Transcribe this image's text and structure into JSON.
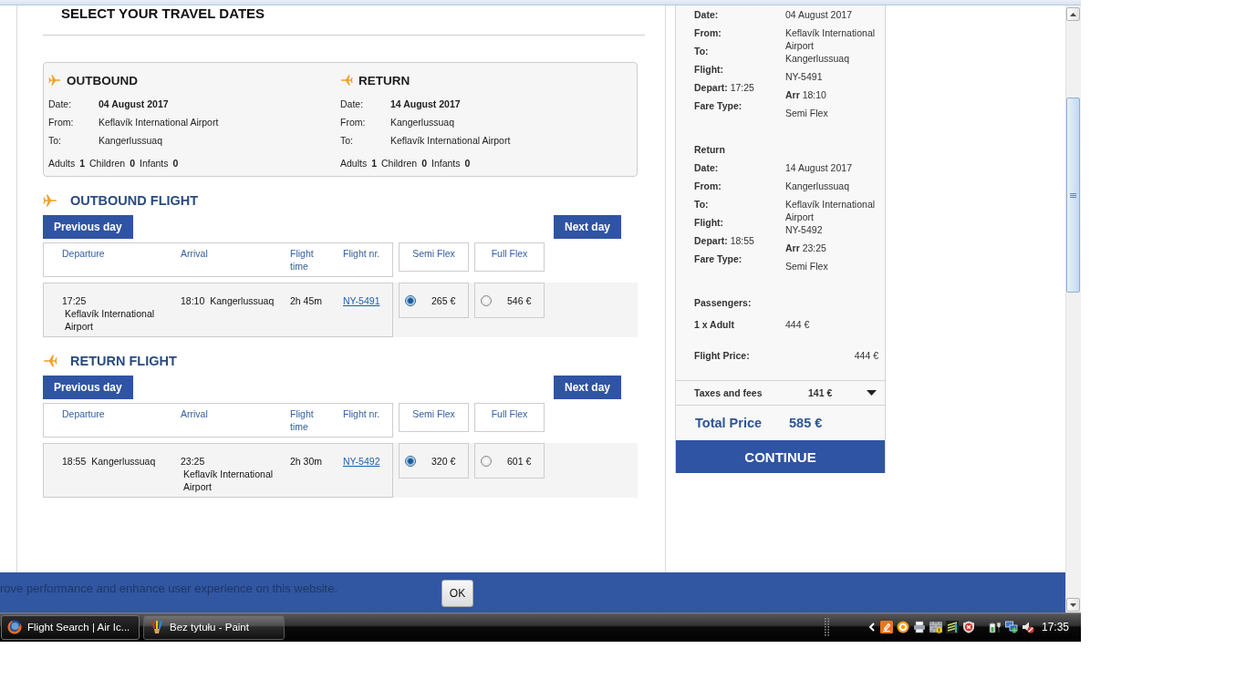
{
  "page": {
    "title": "SELECT YOUR TRAVEL DATES"
  },
  "trip_summary": [
    {
      "kind": "outbound",
      "heading": "OUTBOUND",
      "fields": [
        {
          "label": "Date:",
          "value": "04 August 2017"
        },
        {
          "label": "From:",
          "value": "Keflavík International Airport"
        },
        {
          "label": "To:",
          "value": "Kangerlussuaq"
        }
      ],
      "passengers": [
        {
          "label": "Adults",
          "count": "1"
        },
        {
          "label": "Children",
          "count": "0"
        },
        {
          "label": "Infants",
          "count": "0"
        }
      ]
    },
    {
      "kind": "return",
      "heading": "RETURN",
      "fields": [
        {
          "label": "Date:",
          "value": "14 August 2017"
        },
        {
          "label": "From:",
          "value": "Kangerlussuaq"
        },
        {
          "label": "To:",
          "value": "Keflavík International Airport"
        }
      ],
      "passengers": [
        {
          "label": "Adults",
          "count": "1"
        },
        {
          "label": "Children",
          "count": "0"
        },
        {
          "label": "Infants",
          "count": "0"
        }
      ]
    }
  ],
  "flights": [
    {
      "kind": "outbound",
      "heading": "OUTBOUND FLIGHT",
      "previous_day": "Previous day",
      "next_day": "Next day",
      "columns": [
        "Departure",
        "Arrival",
        "Flight time",
        "Flight nr."
      ],
      "fare_columns": [
        "Semi Flex",
        "Full Flex"
      ],
      "rows": [
        {
          "departure_time": "17:25",
          "departure_airport": "Keflavík International Airport",
          "arrival_time": "18:10",
          "arrival_airport": "Kangerlussuaq",
          "flight_time": "2h 45m",
          "flight_nr": "NY-5491",
          "fares": [
            {
              "price": "265 €",
              "selected": true
            },
            {
              "price": "546 €",
              "selected": false
            }
          ]
        }
      ]
    },
    {
      "kind": "return",
      "heading": "RETURN FLIGHT",
      "previous_day": "Previous day",
      "next_day": "Next day",
      "columns": [
        "Departure",
        "Arrival",
        "Flight time",
        "Flight nr."
      ],
      "fare_columns": [
        "Semi Flex",
        "Full Flex"
      ],
      "rows": [
        {
          "departure_time": "18:55",
          "departure_airport": "Kangerlussuaq",
          "arrival_time": "23:25",
          "arrival_airport": "Keflavík International Airport",
          "flight_time": "2h 30m",
          "flight_nr": "NY-5492",
          "fares": [
            {
              "price": "320 €",
              "selected": true
            },
            {
              "price": "601 €",
              "selected": false
            }
          ]
        }
      ]
    }
  ],
  "booking_summary": {
    "legs": [
      {
        "rows": [
          {
            "label": "Date:",
            "value": "04 August 2017"
          },
          {
            "label": "From:",
            "value": "Keflavík International Airport"
          },
          {
            "label": "To:",
            "value": "Kangerlussuaq"
          },
          {
            "label": "Flight:",
            "value": "NY-5491"
          },
          {
            "label": "Depart:",
            "time": "17:25",
            "value_label": "Arr",
            "value": "18:10"
          },
          {
            "label": "Fare Type:",
            "value": "Semi Flex"
          }
        ]
      },
      {
        "heading": "Return",
        "rows": [
          {
            "label": "Date:",
            "value": "14 August 2017"
          },
          {
            "label": "From:",
            "value": "Kangerlussuaq"
          },
          {
            "label": "To:",
            "value": "Keflavík International Airport"
          },
          {
            "label": "Flight:",
            "value": "NY-5492"
          },
          {
            "label": "Depart:",
            "time": "18:55",
            "value_label": "Arr",
            "value": "23:25"
          },
          {
            "label": "Fare Type:",
            "value": "Semi Flex"
          }
        ]
      }
    ],
    "passengers": {
      "heading": "Passengers:",
      "rows": [
        {
          "label": "1 x Adult",
          "value": "444 €"
        }
      ]
    },
    "flight_price": {
      "label": "Flight Price:",
      "value": "444 €"
    },
    "taxes": {
      "label": "Taxes and fees",
      "value": "141 €",
      "expanded": false
    },
    "total": {
      "label": "Total Price",
      "value": "585 €"
    },
    "continue_button": "CONTINUE"
  },
  "cookie_bar": {
    "text": "rove performance and enhance user experience on this website.",
    "button": "OK"
  },
  "taskbar": {
    "tasks": [
      {
        "kind": "browser",
        "label": "Flight Search | Air Ic...",
        "selected": true
      },
      {
        "kind": "paint",
        "label": "Bez tytułu - Paint",
        "selected": false
      }
    ],
    "clock": "17:35"
  }
}
